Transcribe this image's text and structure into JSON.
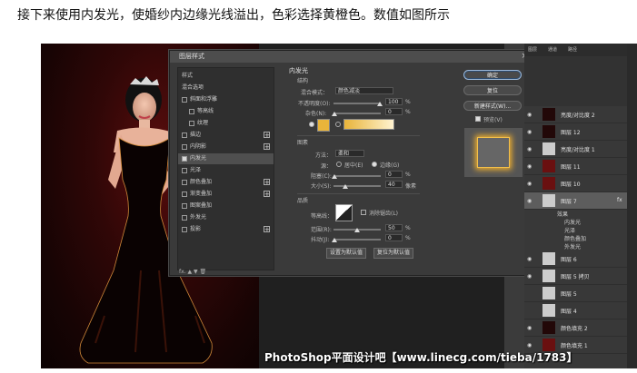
{
  "caption": "接下来使用内发光，使婚纱内边缘光线溢出，色彩选择黄橙色。数值如图所示",
  "dialog": {
    "title": "图层样式",
    "close": "×",
    "left_items": [
      {
        "label": "样式",
        "checkbox": false,
        "indent": false,
        "plus": false,
        "active": false
      },
      {
        "label": "混合选项",
        "checkbox": false,
        "indent": false,
        "plus": false,
        "active": false
      },
      {
        "label": "斜面和浮雕",
        "checkbox": true,
        "indent": false,
        "plus": false,
        "active": false
      },
      {
        "label": "等高线",
        "checkbox": true,
        "indent": true,
        "plus": false,
        "active": false
      },
      {
        "label": "纹理",
        "checkbox": true,
        "indent": true,
        "plus": false,
        "active": false
      },
      {
        "label": "描边",
        "checkbox": true,
        "indent": false,
        "plus": true,
        "active": false
      },
      {
        "label": "内阴影",
        "checkbox": true,
        "indent": false,
        "plus": true,
        "active": false
      },
      {
        "label": "内发光",
        "checkbox": true,
        "indent": false,
        "plus": false,
        "active": true
      },
      {
        "label": "光泽",
        "checkbox": true,
        "indent": false,
        "plus": false,
        "active": false
      },
      {
        "label": "颜色叠加",
        "checkbox": true,
        "indent": false,
        "plus": true,
        "active": false
      },
      {
        "label": "渐变叠加",
        "checkbox": true,
        "indent": false,
        "plus": true,
        "active": false
      },
      {
        "label": "图案叠加",
        "checkbox": true,
        "indent": false,
        "plus": false,
        "active": false
      },
      {
        "label": "外发光",
        "checkbox": true,
        "indent": false,
        "plus": false,
        "active": false
      },
      {
        "label": "投影",
        "checkbox": true,
        "indent": false,
        "plus": true,
        "active": false
      }
    ],
    "left_footer": "fx. ▲ ▼  🗑",
    "inner_glow": {
      "title": "内发光",
      "structure": "结构",
      "blend_mode_label": "混合模式：",
      "blend_mode_value": "颜色减淡",
      "opacity_label": "不透明度(O):",
      "opacity_value": "100",
      "opacity_unit": "%",
      "noise_label": "杂色(N):",
      "noise_value": "0",
      "noise_unit": "%",
      "glow_color": "#e8b43a",
      "elements": "图素",
      "method_label": "方法：",
      "method_value": "柔和",
      "source_label": "源：",
      "source_center": "居中(E)",
      "source_edge": "边缘(G)",
      "choke_label": "阻塞(C):",
      "choke_value": "0",
      "choke_unit": "%",
      "size_label": "大小(S):",
      "size_value": "40",
      "size_unit": "像素",
      "quality": "品质",
      "contour_label": "等高线：",
      "anti_alias_label": "消除锯齿(L)",
      "range_label": "范围(R):",
      "range_value": "50",
      "range_unit": "%",
      "jitter_label": "抖动(J):",
      "jitter_value": "0",
      "jitter_unit": "%",
      "reset_default": "设置为默认值",
      "restore_default": "复位为默认值"
    },
    "buttons": {
      "ok": "确定",
      "cancel": "复位",
      "new_style": "新建样式(W)...",
      "preview": "预览(V)"
    }
  },
  "layers_panel": {
    "tabs": [
      "图层",
      "通道",
      "路径"
    ],
    "rows": [
      {
        "name": "亮度/对比度 2",
        "thumb": "dark",
        "eye": true,
        "selected": false
      },
      {
        "name": "图层 12",
        "thumb": "dark",
        "eye": true,
        "selected": false
      },
      {
        "name": "亮度/对比度 1",
        "thumb": "light",
        "eye": true,
        "selected": false
      },
      {
        "name": "图层 11",
        "thumb": "red",
        "eye": true,
        "selected": false
      },
      {
        "name": "图层 10",
        "thumb": "red",
        "eye": true,
        "selected": false
      },
      {
        "name": "图层 7",
        "thumb": "light",
        "eye": true,
        "selected": true
      }
    ],
    "effects": [
      "效果",
      "内发光",
      "光泽",
      "颜色叠加",
      "外发光"
    ],
    "rows_after": [
      {
        "name": "图层 6",
        "thumb": "light",
        "eye": true,
        "selected": false
      },
      {
        "name": "图层 5 拷贝",
        "thumb": "light",
        "eye": true,
        "selected": false
      },
      {
        "name": "图层 5",
        "thumb": "light",
        "eye": false,
        "selected": false
      },
      {
        "name": "图层 4",
        "thumb": "light",
        "eye": false,
        "selected": false
      },
      {
        "name": "颜色填充 2",
        "thumb": "dark",
        "eye": true,
        "selected": false
      },
      {
        "name": "颜色填充 1",
        "thumb": "red",
        "eye": true,
        "selected": false
      }
    ],
    "fx_label": "fx"
  },
  "watermark": "PhotoShop平面设计吧【www.linecg.com/tieba/1783】"
}
